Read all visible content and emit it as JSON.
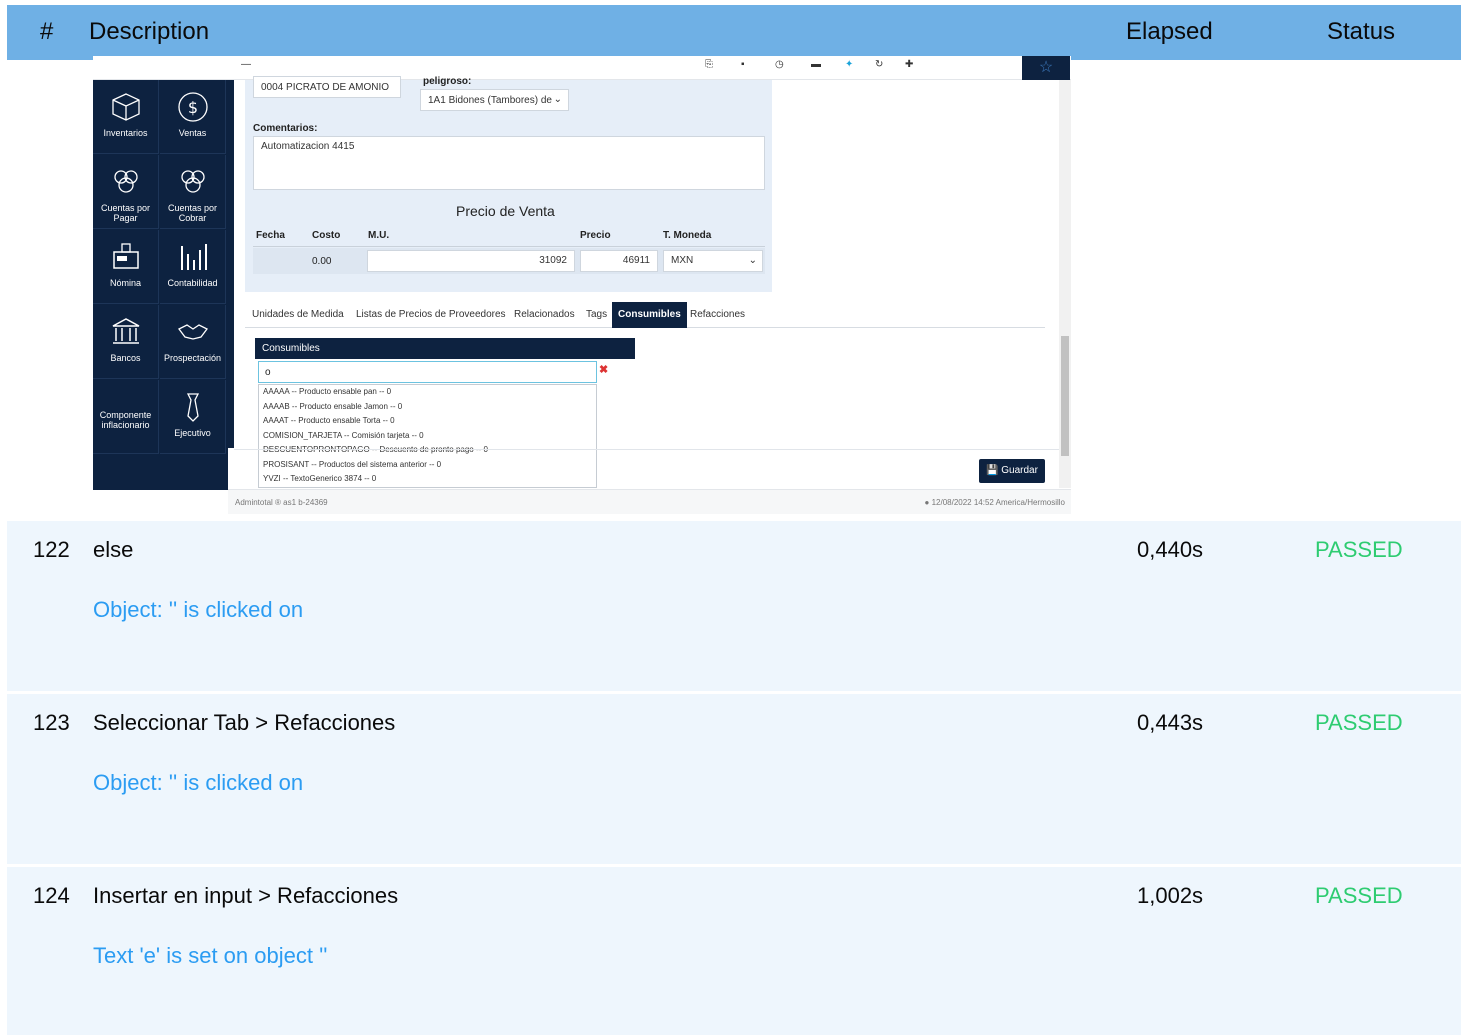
{
  "header": {
    "num": "#",
    "description": "Description",
    "elapsed": "Elapsed",
    "status": "Status"
  },
  "screenshot": {
    "topbar_icons": [
      "document-icon",
      "save-icon",
      "clock-icon",
      "calculator-icon",
      "pin-icon",
      "refresh-icon",
      "plus-icon"
    ],
    "sidebar": [
      {
        "label": "Inventarios",
        "icon": "box-icon"
      },
      {
        "label": "Ventas",
        "icon": "dollar-icon"
      },
      {
        "label": "Cuentas por Pagar",
        "icon": "people-icon"
      },
      {
        "label": "Cuentas por Cobrar",
        "icon": "people-icon"
      },
      {
        "label": "Nómina",
        "icon": "register-icon"
      },
      {
        "label": "Contabilidad",
        "icon": "bar-chart-icon"
      },
      {
        "label": "Bancos",
        "icon": "bank-icon"
      },
      {
        "label": "Prospectación",
        "icon": "handshake-icon"
      },
      {
        "label": "Componente inflacionario",
        "icon": ""
      },
      {
        "label": "Ejecutivo",
        "icon": "tie-icon"
      }
    ],
    "form": {
      "product_field": "0004 PICRATO DE AMONIO",
      "hazard_label": "peligroso:",
      "hazard_select": "1A1 Bidones (Tambores) de",
      "comments_label": "Comentarios:",
      "comments_value": "Automatizacion 4415",
      "price_title": "Precio de Venta",
      "columns": [
        "Fecha",
        "Costo",
        "M.U.",
        "Precio",
        "T. Moneda"
      ],
      "row": {
        "fecha": "",
        "costo": "0.00",
        "mu": "31092",
        "precio": "46911",
        "moneda": "MXN"
      }
    },
    "tabs": [
      {
        "label": "Unidades de Medida",
        "active": false
      },
      {
        "label": "Listas de Precios de Proveedores",
        "active": false
      },
      {
        "label": "Relacionados",
        "active": false
      },
      {
        "label": "Tags",
        "active": false
      },
      {
        "label": "Consumibles",
        "active": true
      },
      {
        "label": "Refacciones",
        "active": false
      }
    ],
    "consumibles": {
      "title": "Consumibles",
      "input_value": "o",
      "options": [
        "AAAAA -- Producto ensable pan -- 0",
        "AAAAB -- Producto ensable Jamon -- 0",
        "AAAAT -- Producto ensable Torta -- 0",
        "COMISION_TARJETA -- Comisión tarjeta -- 0",
        "DESCUENTOPRONTOPAGO -- Descuento de pronto pago -- 0",
        "PROSISANT -- Productos del sistema anterior -- 0",
        "YVZI -- TextoGenerico 3874 -- 0"
      ]
    },
    "save_label": "Guardar",
    "footer_left": "Admintotal ® as1 b-24369",
    "footer_right": "12/08/2022 14:52 America/Hermosillo"
  },
  "rows": [
    {
      "num": "122",
      "description": "else",
      "elapsed": "0,440s",
      "status": "PASSED",
      "detail": "Object: '' is clicked on"
    },
    {
      "num": "123",
      "description": "Seleccionar Tab > Refacciones",
      "elapsed": "0,443s",
      "status": "PASSED",
      "detail": "Object: '' is clicked on"
    },
    {
      "num": "124",
      "description": "Insertar en input > Refacciones",
      "elapsed": "1,002s",
      "status": "PASSED",
      "detail": "Text 'e' is set on object ''"
    }
  ],
  "colors": {
    "header_bg": "#6fb0e5",
    "row_bg": "#eef6fd",
    "passed": "#2ecc71",
    "detail": "#2b9cf2",
    "navy": "#0d2240"
  }
}
